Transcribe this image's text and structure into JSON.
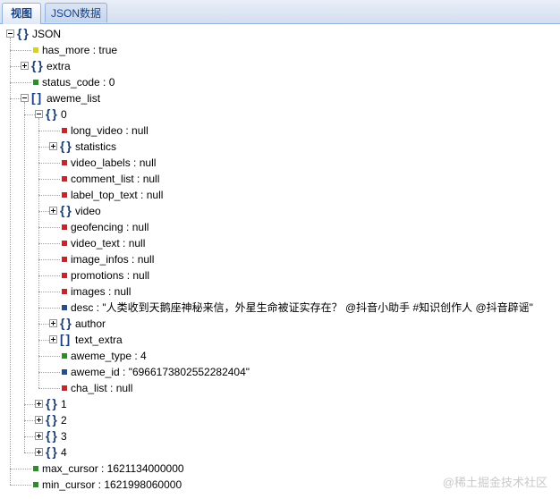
{
  "tabs": [
    {
      "label": "视图",
      "active": true
    },
    {
      "label": "JSON数据",
      "active": false
    }
  ],
  "tree": {
    "root": "JSON",
    "rows": [
      {
        "label": "JSON",
        "indent": 0,
        "kind": "object",
        "expanded": true
      },
      {
        "label": "has_more : true",
        "indent": 1,
        "kind": "leaf",
        "color": "yellow"
      },
      {
        "label": "extra",
        "indent": 1,
        "kind": "object",
        "expanded": false
      },
      {
        "label": "status_code : 0",
        "indent": 1,
        "kind": "leaf",
        "color": "green"
      },
      {
        "label": "aweme_list",
        "indent": 1,
        "kind": "array",
        "expanded": true
      },
      {
        "label": "0",
        "indent": 2,
        "kind": "object",
        "expanded": true
      },
      {
        "label": "long_video : null",
        "indent": 3,
        "kind": "leaf",
        "color": "red"
      },
      {
        "label": "statistics",
        "indent": 3,
        "kind": "object",
        "expanded": false
      },
      {
        "label": "video_labels : null",
        "indent": 3,
        "kind": "leaf",
        "color": "red"
      },
      {
        "label": "comment_list : null",
        "indent": 3,
        "kind": "leaf",
        "color": "red"
      },
      {
        "label": "label_top_text : null",
        "indent": 3,
        "kind": "leaf",
        "color": "red"
      },
      {
        "label": "video",
        "indent": 3,
        "kind": "object",
        "expanded": false
      },
      {
        "label": "geofencing : null",
        "indent": 3,
        "kind": "leaf",
        "color": "red"
      },
      {
        "label": "video_text : null",
        "indent": 3,
        "kind": "leaf",
        "color": "red"
      },
      {
        "label": "image_infos : null",
        "indent": 3,
        "kind": "leaf",
        "color": "red"
      },
      {
        "label": "promotions : null",
        "indent": 3,
        "kind": "leaf",
        "color": "red"
      },
      {
        "label": "images : null",
        "indent": 3,
        "kind": "leaf",
        "color": "red"
      },
      {
        "label": "desc : \"人类收到天鹅座神秘来信，外星生命被证实存在？ @抖音小助手 #知识创作人 @抖音辟谣\"",
        "indent": 3,
        "kind": "leaf",
        "color": "blue"
      },
      {
        "label": "author",
        "indent": 3,
        "kind": "object",
        "expanded": false
      },
      {
        "label": "text_extra",
        "indent": 3,
        "kind": "array",
        "expanded": false
      },
      {
        "label": "aweme_type : 4",
        "indent": 3,
        "kind": "leaf",
        "color": "green"
      },
      {
        "label": "aweme_id : \"6966173802552282404\"",
        "indent": 3,
        "kind": "leaf",
        "color": "blue"
      },
      {
        "label": "cha_list : null",
        "indent": 3,
        "kind": "leaf",
        "color": "red"
      },
      {
        "label": "1",
        "indent": 2,
        "kind": "object",
        "expanded": false
      },
      {
        "label": "2",
        "indent": 2,
        "kind": "object",
        "expanded": false
      },
      {
        "label": "3",
        "indent": 2,
        "kind": "object",
        "expanded": false
      },
      {
        "label": "4",
        "indent": 2,
        "kind": "object",
        "expanded": false
      },
      {
        "label": "max_cursor : 1621134000000",
        "indent": 1,
        "kind": "leaf",
        "color": "green"
      },
      {
        "label": "min_cursor : 1621998060000",
        "indent": 1,
        "kind": "leaf",
        "color": "green"
      }
    ]
  },
  "watermark": "@稀土掘金技术社区",
  "colors": {
    "red": "#c0282d",
    "green": "#2e8b2e",
    "yellow": "#d8cf2a",
    "blue": "#2a4b8c",
    "brace": "#1a3f7a",
    "tab_border": "#8db2e3"
  }
}
